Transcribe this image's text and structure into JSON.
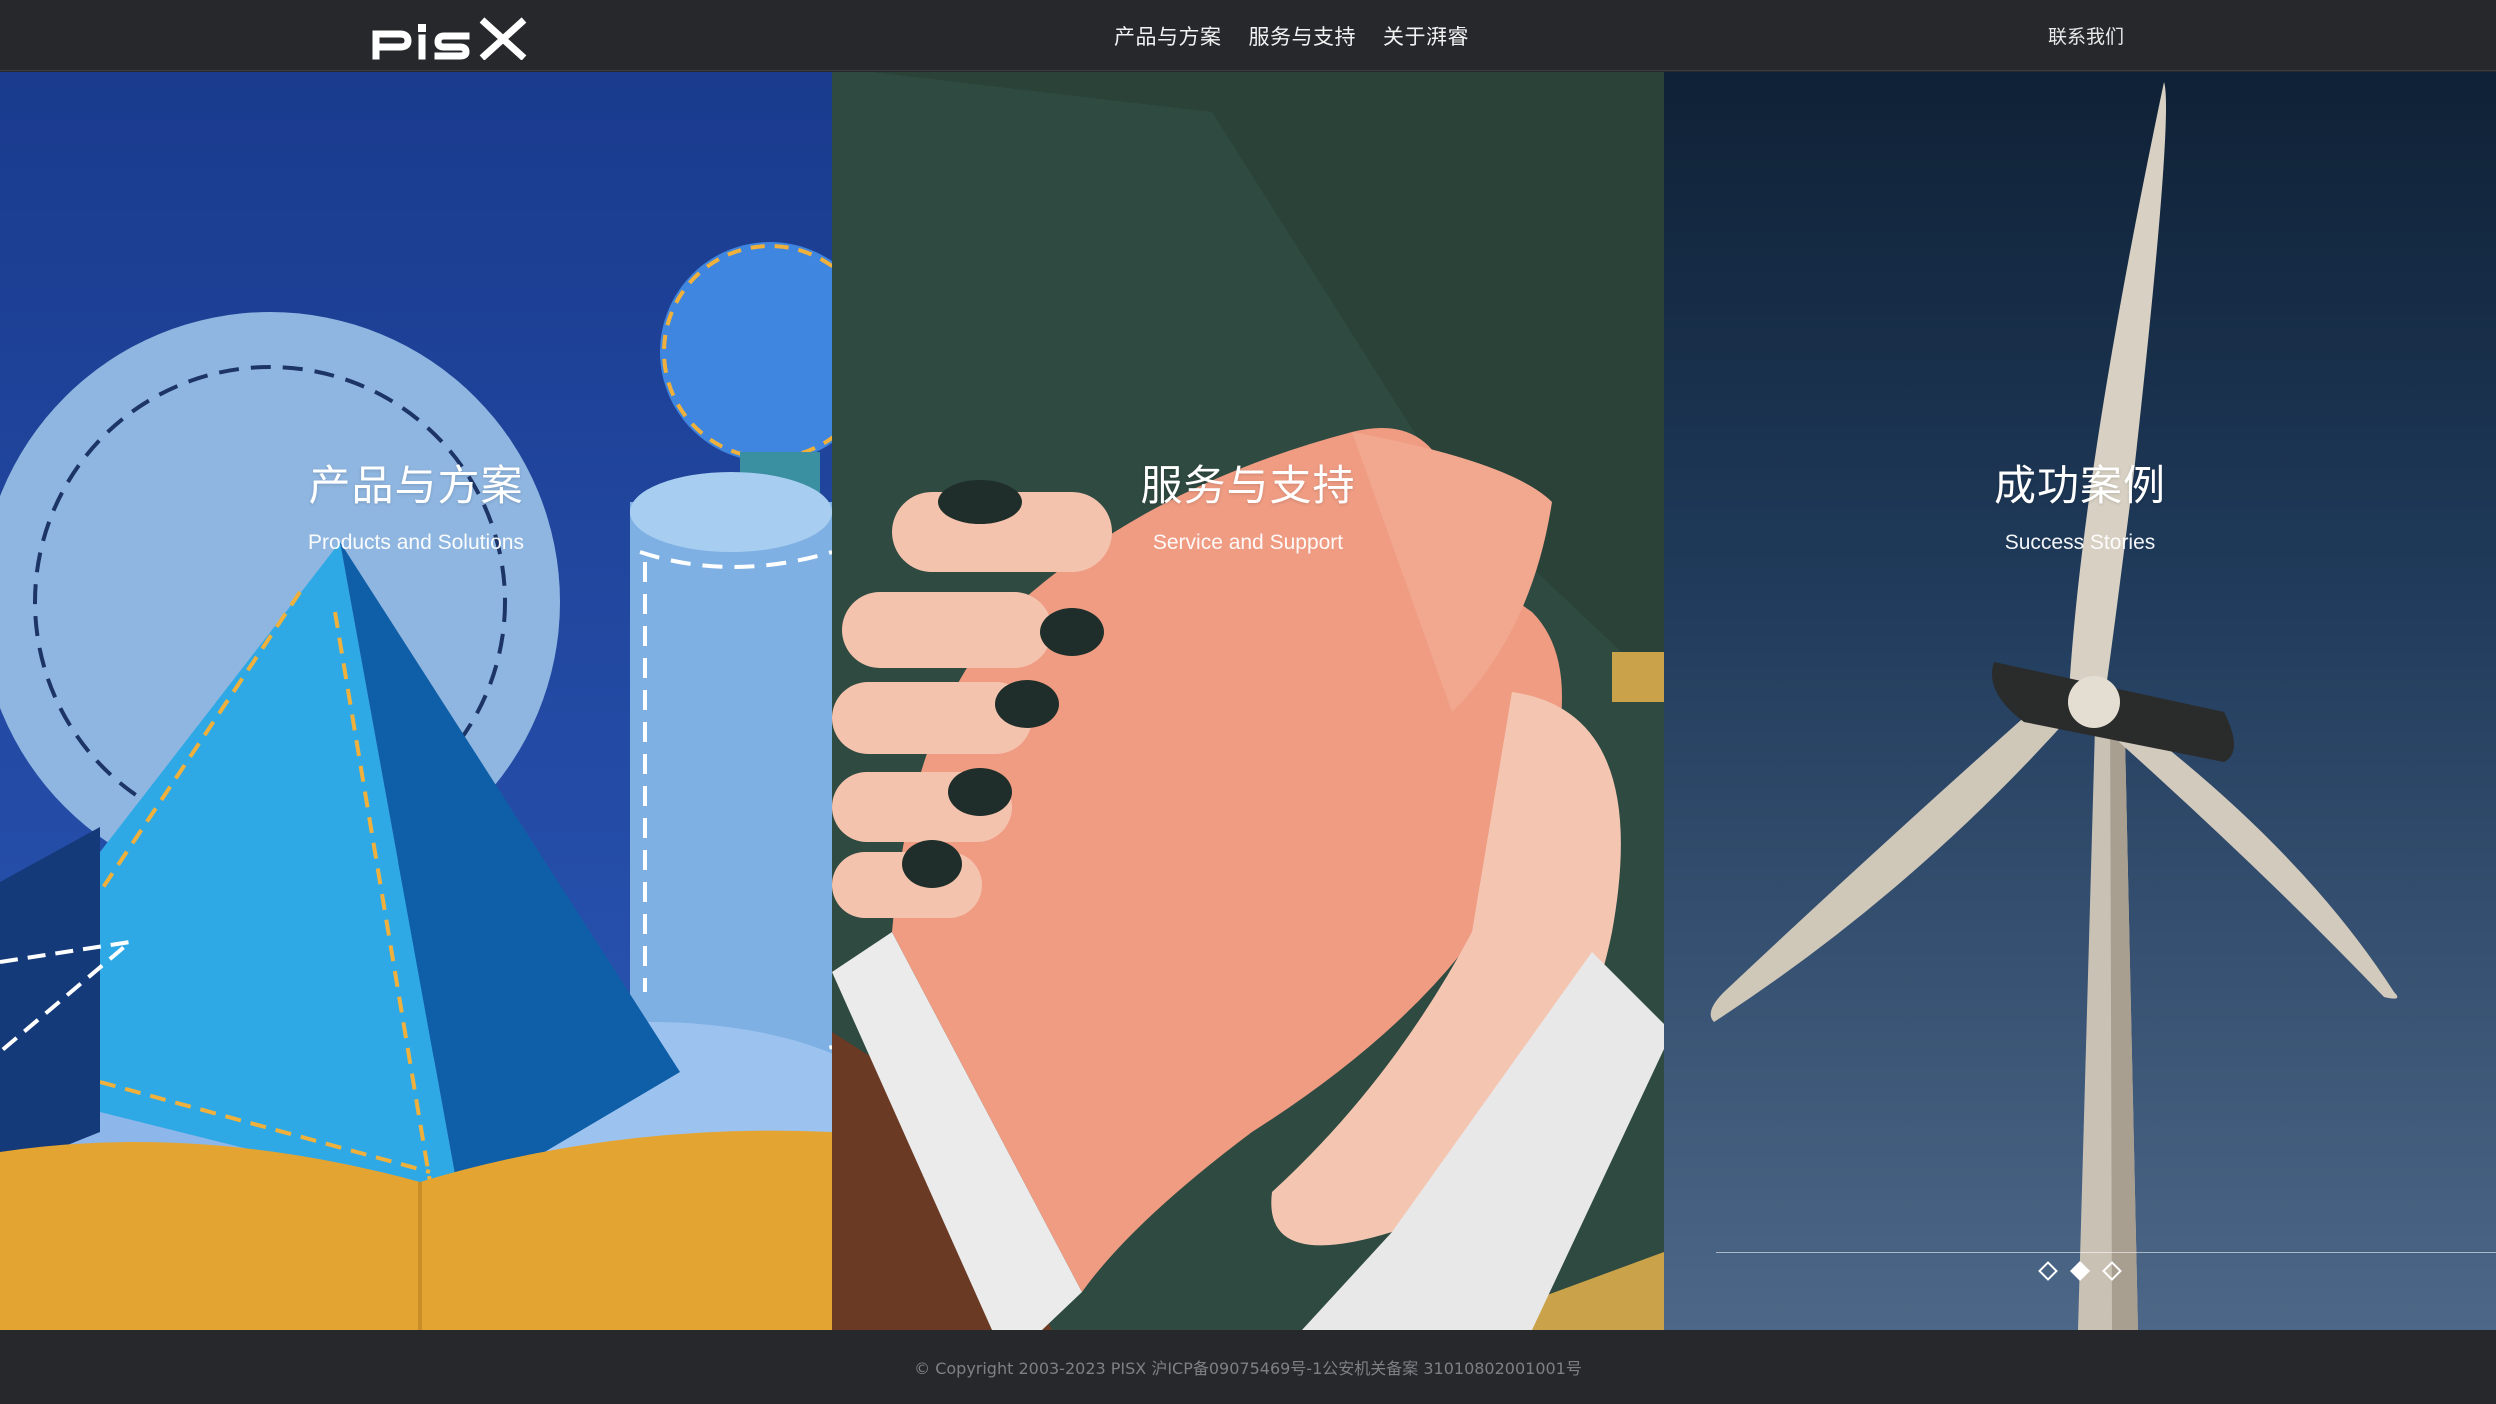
{
  "brand": {
    "logo_text": "PISX"
  },
  "nav": {
    "items": [
      {
        "label": "产品与方案"
      },
      {
        "label": "服务与支持"
      },
      {
        "label": "关于湃睿"
      }
    ],
    "contact_label": "联系我们"
  },
  "panels": [
    {
      "title": "产品与方案",
      "subtitle": "Products and Solutions",
      "bg": "#1c3e8c"
    },
    {
      "title": "服务与支持",
      "subtitle": "Service and Support",
      "bg": "#2f4a40"
    },
    {
      "title": "成功案例",
      "subtitle": "Success Stories",
      "bg": "#253d5e"
    }
  ],
  "slider": {
    "dots": 3,
    "active_index": 1
  },
  "footer": {
    "text": "© Copyright 2003-2023 PISX 沪ICP备09075469号-1公安机关备案 31010802001001号"
  },
  "colors": {
    "header_bg": "#26282c",
    "footer_text": "#7e8086"
  }
}
